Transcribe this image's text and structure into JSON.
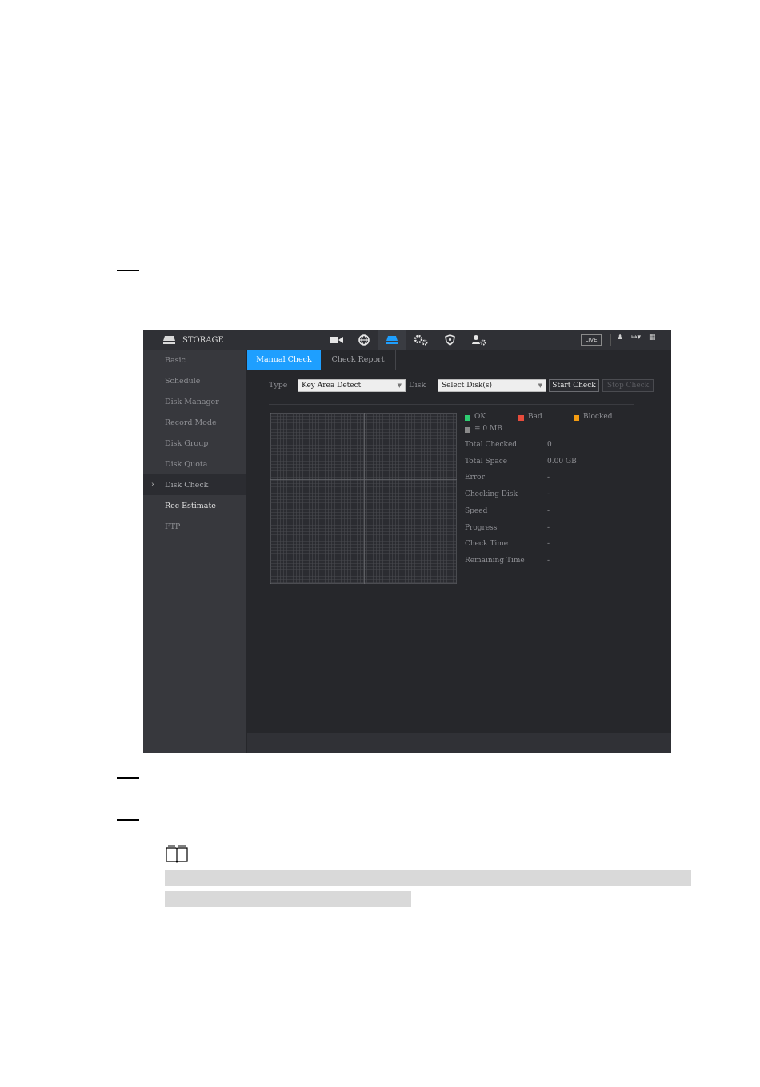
{
  "header": {
    "title": "STORAGE",
    "live_label": "LIVE"
  },
  "nav_icons": [
    "camera-icon",
    "network-icon",
    "storage-icon",
    "settings-icon",
    "security-icon",
    "account-icon"
  ],
  "sidebar": {
    "items": [
      {
        "label": "Basic"
      },
      {
        "label": "Schedule"
      },
      {
        "label": "Disk Manager"
      },
      {
        "label": "Record Mode"
      },
      {
        "label": "Disk Group"
      },
      {
        "label": "Disk Quota"
      },
      {
        "label": "Disk Check",
        "active": true
      },
      {
        "label": "Rec Estimate"
      },
      {
        "label": "FTP"
      }
    ]
  },
  "tabs": [
    {
      "label": "Manual Check",
      "active": true
    },
    {
      "label": "Check Report"
    }
  ],
  "form": {
    "type_label": "Type",
    "type_value": "Key Area Detect",
    "disk_label": "Disk",
    "disk_value": "Select Disk(s)",
    "start_label": "Start Check",
    "stop_label": "Stop Check"
  },
  "legend": {
    "ok": "OK",
    "bad": "Bad",
    "blocked": "Blocked",
    "unit": "= 0 MB",
    "colors": {
      "ok": "#2ecc71",
      "bad": "#e74c3c",
      "blocked": "#f39c12",
      "unit": "#8a8a8a"
    }
  },
  "info": [
    {
      "label": "Total Checked",
      "value": "0"
    },
    {
      "label": "Total Space",
      "value": "0.00 GB"
    },
    {
      "label": "Error",
      "value": "-"
    },
    {
      "label": "Checking Disk",
      "value": "-"
    },
    {
      "label": "Speed",
      "value": "-"
    },
    {
      "label": "Progress",
      "value": "-"
    },
    {
      "label": "Check Time",
      "value": "-"
    },
    {
      "label": "Remaining Time",
      "value": "-"
    }
  ]
}
